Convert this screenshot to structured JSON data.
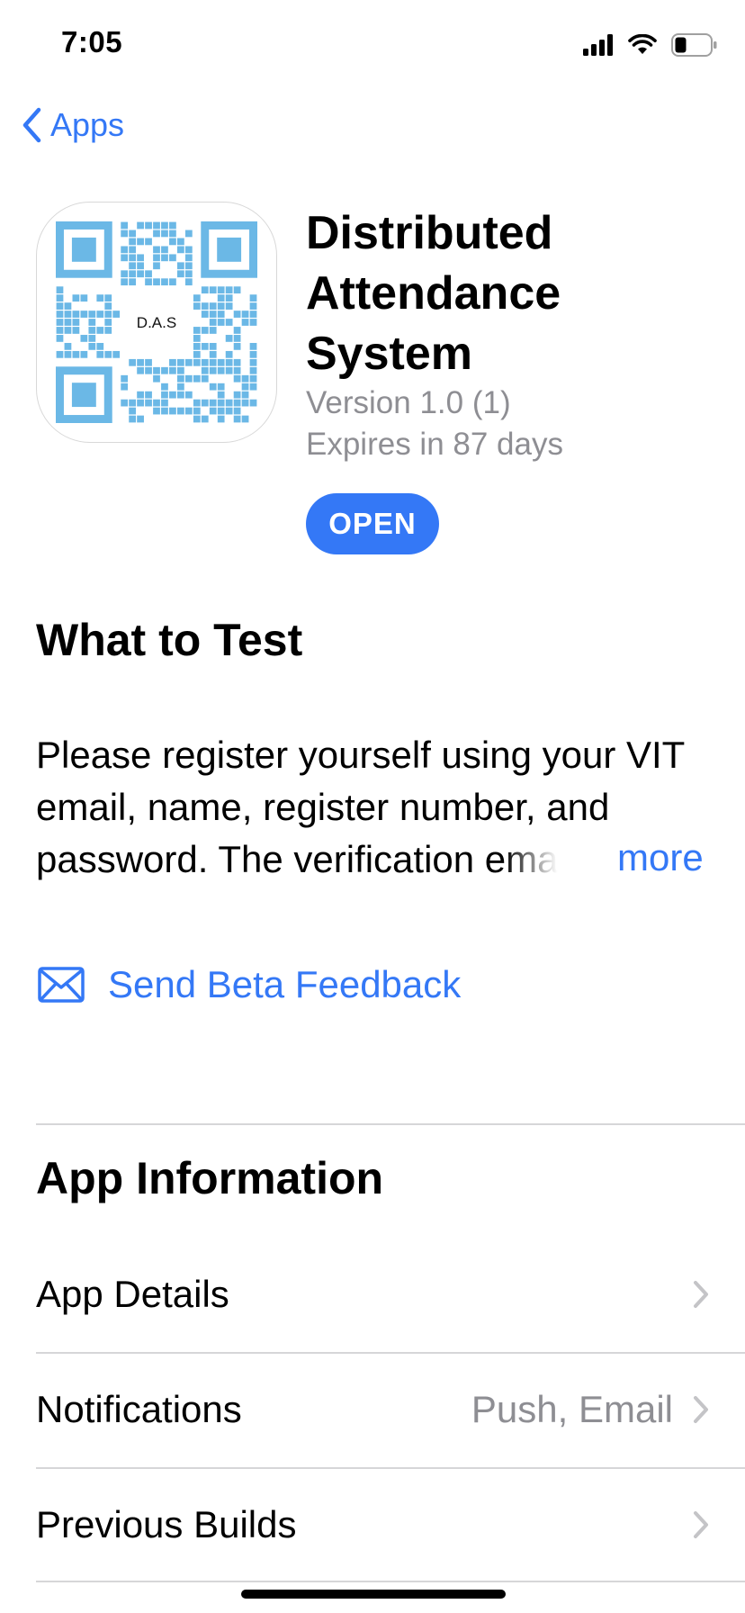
{
  "status_bar": {
    "time": "7:05"
  },
  "nav": {
    "back_label": "Apps"
  },
  "app": {
    "title": "Distributed Attendance System",
    "icon_text": "D.A.S",
    "version": "Version 1.0 (1)",
    "expires": "Expires in 87 days",
    "open_label": "OPEN"
  },
  "what_to_test": {
    "title": "What to Test",
    "body": "Please register yourself using your VIT email, name, register number, and password. The verification emai",
    "more_label": "more"
  },
  "feedback": {
    "label": "Send Beta Feedback"
  },
  "app_information": {
    "title": "App Information",
    "rows": [
      {
        "label": "App Details",
        "value": ""
      },
      {
        "label": "Notifications",
        "value": "Push, Email"
      },
      {
        "label": "Previous Builds",
        "value": ""
      }
    ]
  },
  "colors": {
    "accent": "#3478f6",
    "secondary_text": "#8e8e93",
    "qr": "#6bb8e6"
  }
}
